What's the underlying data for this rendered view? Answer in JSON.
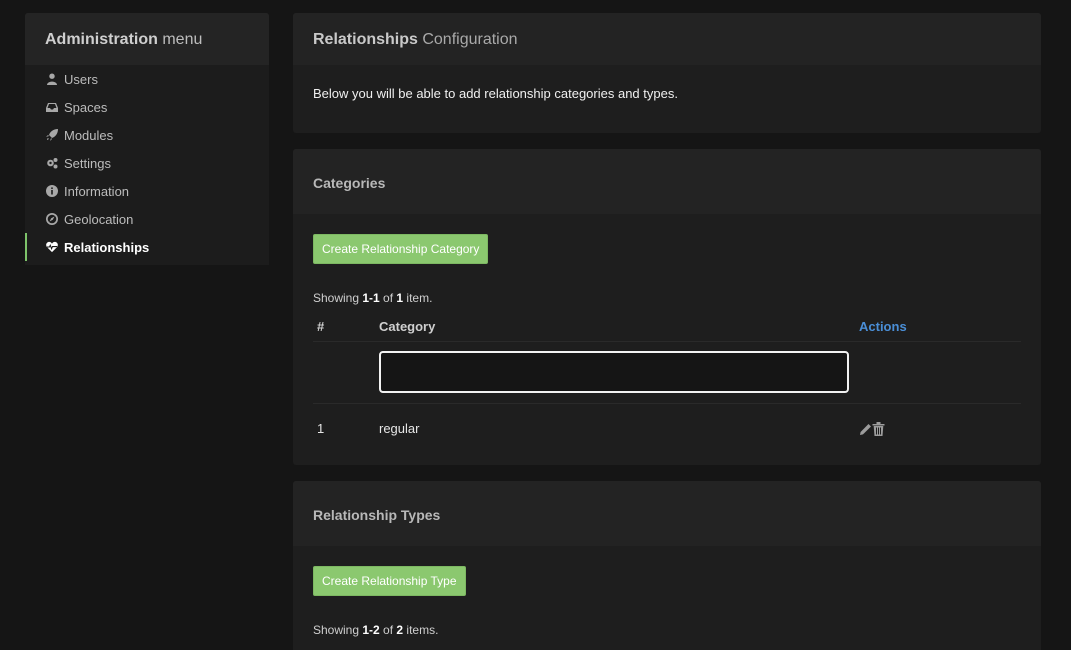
{
  "sidebar": {
    "title_bold": "Administration",
    "title_rest": " menu",
    "items": [
      {
        "label": "Users",
        "icon": "user-icon"
      },
      {
        "label": "Spaces",
        "icon": "inbox-icon"
      },
      {
        "label": "Modules",
        "icon": "rocket-icon"
      },
      {
        "label": "Settings",
        "icon": "gears-icon"
      },
      {
        "label": "Information",
        "icon": "info-icon"
      },
      {
        "label": "Geolocation",
        "icon": "compass-icon"
      },
      {
        "label": "Relationships",
        "icon": "heartbeat-icon",
        "active": true
      }
    ]
  },
  "config_panel": {
    "title_bold": "Relationships",
    "title_rest": " Configuration",
    "description": "Below you will be able to add relationship categories and types."
  },
  "categories": {
    "title": "Categories",
    "create_button": "Create Relationship Category",
    "summary": {
      "prefix": "Showing ",
      "range": "1-1",
      "of": " of ",
      "total": "1",
      "suffix": " item."
    },
    "columns": {
      "num": "#",
      "category": "Category",
      "actions": "Actions"
    },
    "filter_value": "",
    "rows": [
      {
        "num": "1",
        "category": "regular"
      }
    ]
  },
  "types": {
    "title": "Relationship Types",
    "create_button": "Create Relationship Type",
    "summary": {
      "prefix": "Showing ",
      "range": "1-2",
      "of": " of ",
      "total": "2",
      "suffix": " items."
    }
  },
  "colors": {
    "background": "#151515",
    "panel": "#1e1e1e",
    "accent_green": "#8bc86f",
    "link_blue": "#4a8ed6"
  }
}
